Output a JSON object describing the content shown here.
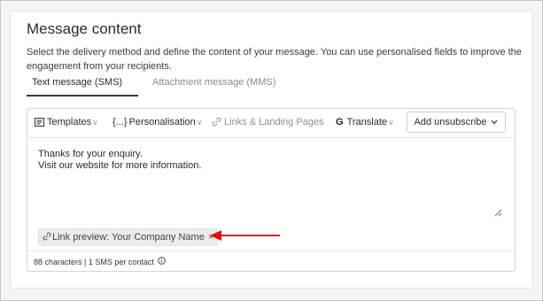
{
  "section": {
    "title": "Message content",
    "description": "Select the delivery method and define the content of your message. You can use personalised fields to improve the engagement from your recipients."
  },
  "tabs": [
    {
      "label": "Text message (SMS)",
      "active": true
    },
    {
      "label": "Attachment message (MMS)",
      "active": false
    }
  ],
  "toolbar": {
    "templates": "Templates",
    "personalisation": "Personalisation",
    "personalisation_icon": "{...}",
    "links": "Links & Landing Pages",
    "translate": "Translate",
    "translate_icon": "G",
    "unsubscribe": "Add unsubscribe"
  },
  "message": {
    "lines": [
      "Thanks for your enquiry.",
      "Visit our website for more information."
    ]
  },
  "link_preview": {
    "label": "Link preview: Your Company Name"
  },
  "footer": {
    "count": "88 characters | 1 SMS per contact"
  },
  "colors": {
    "arrow": "#e01010",
    "card_border": "#e3e3e3"
  }
}
